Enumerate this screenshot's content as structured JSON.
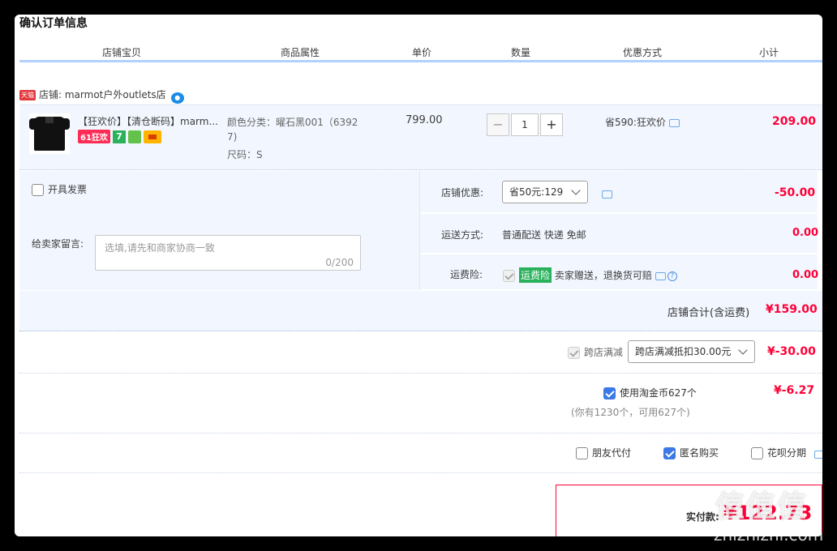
{
  "page": {
    "title": "确认订单信息"
  },
  "columns": [
    "店铺宝贝",
    "商品属性",
    "单价",
    "数量",
    "优惠方式",
    "小计"
  ],
  "store": {
    "badge": "天猫",
    "label": "店铺: marmot户外outlets店"
  },
  "item": {
    "name": "【狂欢价】【清仓断码】marm...",
    "badge_61": "61狂欢",
    "badge_7": "7",
    "attr_color": "颜色分类：曜石黑001（6392",
    "attr_color_cont": "7)",
    "attr_size": "尺码：S",
    "unit_price": "799.00",
    "quantity": "1",
    "minus": "−",
    "plus": "+",
    "discount": "省590:狂欢价",
    "subtotal": "209.00"
  },
  "invoice": {
    "label": "开具发票"
  },
  "message": {
    "label": "给卖家留言:",
    "placeholder": "选填,请先和商家协商一致",
    "counter": "0/200"
  },
  "store_discount": {
    "label": "店铺优惠:",
    "selected": "省50元:129",
    "amount": "-50.00"
  },
  "shipping": {
    "label": "运送方式:",
    "value": "普通配送 快递 免邮",
    "amount": "0.00"
  },
  "insurance": {
    "label": "运费险:",
    "tag": "运费险",
    "text": "卖家赠送，退换货可赔",
    "help": "?",
    "amount": "0.00"
  },
  "store_total": {
    "label": "店铺合计(含运费)",
    "amount": "¥159.00"
  },
  "cross_store": {
    "label": "跨店满减",
    "selected": "跨店满减抵扣30.00元",
    "amount": "¥-30.00"
  },
  "coins": {
    "label": "使用淘金币627个",
    "note": "(你有1230个，可用627个)",
    "amount": "¥-6.27"
  },
  "options": {
    "friend_pay": "朋友代付",
    "anonymous": "匿名购买",
    "installment": "花呗分期"
  },
  "payment": {
    "label": "实付款:",
    "amount": "¥122.73"
  },
  "watermark": {
    "main": "值值值",
    "url": "zhizhizhi.com"
  },
  "colors": {
    "accent": "#ff0036",
    "panel": "#f2f7ff",
    "header_line": "#b2d1ff",
    "checkbox": "#3c78e6"
  }
}
